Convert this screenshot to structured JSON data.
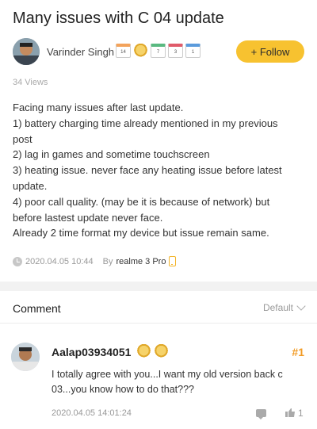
{
  "post": {
    "title": "Many issues with C 04 update",
    "author": "Varinder Singh",
    "follow_label": "+ Follow",
    "views": "34 Views",
    "body": [
      "Facing many issues after last update.",
      "1) battery charging time already mentioned in my previous post",
      "2) lag in games and sometime touchscreen",
      "3) heating issue. never face any heating issue before latest update.",
      "4) poor call quality. (may be it is because of network) but before lastest update never face.",
      "Already 2 time format my device but issue remain same."
    ],
    "date": "2020.04.05 10:44",
    "by_label": "By",
    "device": "realme 3 Pro",
    "badges": [
      "14",
      "medal",
      "7",
      "3",
      "1"
    ]
  },
  "comments_section": {
    "heading": "Comment",
    "sort": "Default"
  },
  "comment": {
    "user": "Aalap03934051",
    "floor": "#1",
    "text": "I totally agree with you...I want my old version back c 03...you know how to do that???",
    "time": "2020.04.05 14:01:24",
    "likes": "1"
  },
  "colors": {
    "accent": "#f7c230",
    "floor": "#f29b24"
  }
}
